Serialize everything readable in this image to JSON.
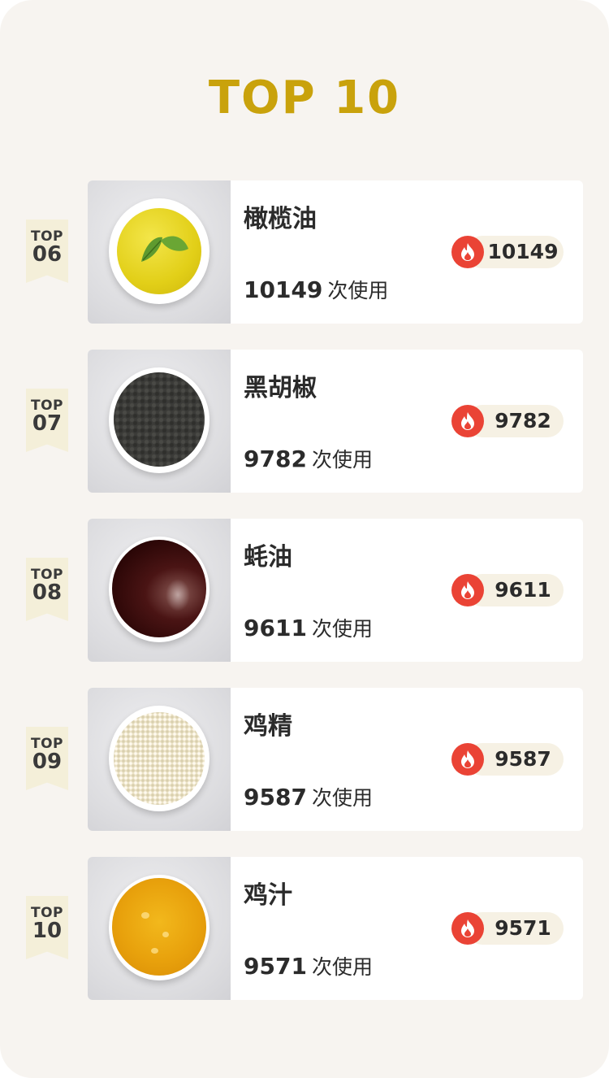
{
  "title": "TOP 10",
  "colors": {
    "accent_gold": "#c9a20c",
    "fire_red": "#ea4335",
    "panel_bg": "#f7f4f0",
    "badge_bg": "#f4efd9"
  },
  "items": [
    {
      "rank_label": "TOP",
      "rank": "06",
      "name": "橄榄油",
      "usage_count": "10149",
      "usage_suffix": "次使用",
      "heat": "10149",
      "heat_icon": "fire-icon",
      "image": "olive-oil-bowl"
    },
    {
      "rank_label": "TOP",
      "rank": "07",
      "name": "黑胡椒",
      "usage_count": "9782",
      "usage_suffix": "次使用",
      "heat": "9782",
      "heat_icon": "fire-icon",
      "image": "black-pepper-bowl"
    },
    {
      "rank_label": "TOP",
      "rank": "08",
      "name": "蚝油",
      "usage_count": "9611",
      "usage_suffix": "次使用",
      "heat": "9611",
      "heat_icon": "fire-icon",
      "image": "oyster-sauce-bowl"
    },
    {
      "rank_label": "TOP",
      "rank": "09",
      "name": "鸡精",
      "usage_count": "9587",
      "usage_suffix": "次使用",
      "heat": "9587",
      "heat_icon": "fire-icon",
      "image": "chicken-essence-bowl"
    },
    {
      "rank_label": "TOP",
      "rank": "10",
      "name": "鸡汁",
      "usage_count": "9571",
      "usage_suffix": "次使用",
      "heat": "9571",
      "heat_icon": "fire-icon",
      "image": "chicken-juice-bowl"
    }
  ]
}
